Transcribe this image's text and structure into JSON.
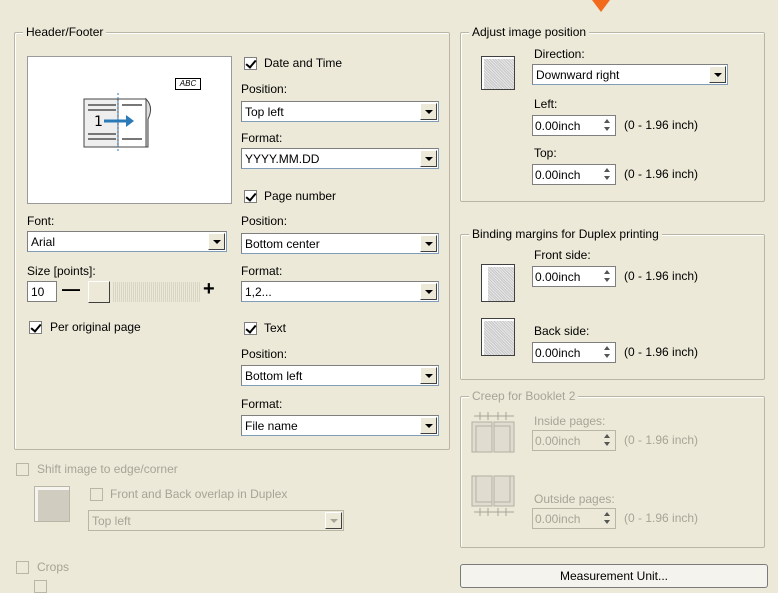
{
  "header_footer": {
    "title": "Header/Footer",
    "preview_tag": "ABC",
    "font_label": "Font:",
    "font_value": "Arial",
    "size_label": "Size [points]:",
    "size_value": "10",
    "size_minus": "—",
    "size_plus": "+",
    "per_original_label": "Per original page",
    "per_original_checked": true,
    "date_time": {
      "label": "Date and Time",
      "checked": true,
      "position_label": "Position:",
      "position_value": "Top left",
      "format_label": "Format:",
      "format_value": "YYYY.MM.DD"
    },
    "page_number": {
      "label": "Page number",
      "checked": true,
      "position_label": "Position:",
      "position_value": "Bottom center",
      "format_label": "Format:",
      "format_value": "1,2..."
    },
    "text": {
      "label": "Text",
      "checked": true,
      "position_label": "Position:",
      "position_value": "Bottom left",
      "format_label": "Format:",
      "format_value": "File name"
    }
  },
  "shift": {
    "label": "Shift image to edge/corner",
    "overlap_label": "Front and Back overlap in Duplex",
    "position_value": "Top left"
  },
  "crops": {
    "label": "Crops"
  },
  "adjust": {
    "title": "Adjust image position",
    "direction_label": "Direction:",
    "direction_value": "Downward right",
    "left_label": "Left:",
    "left_value": "0.00inch",
    "left_range": "(0 - 1.96 inch)",
    "top_label": "Top:",
    "top_value": "0.00inch",
    "top_range": "(0 - 1.96 inch)"
  },
  "binding": {
    "title": "Binding margins for Duplex printing",
    "front_label": "Front side:",
    "front_value": "0.00inch",
    "front_range": "(0 - 1.96 inch)",
    "back_label": "Back side:",
    "back_value": "0.00inch",
    "back_range": "(0 - 1.96 inch)"
  },
  "creep": {
    "title": "Creep for Booklet 2",
    "inside_label": "Inside pages:",
    "inside_value": "0.00inch",
    "inside_range": "(0 - 1.96 inch)",
    "outside_label": "Outside pages:",
    "outside_value": "0.00inch",
    "outside_range": "(0 - 1.96 inch)"
  },
  "measurement_button": "Measurement Unit...",
  "colors": {
    "face": "#ece9d8",
    "accent_arrow": "#f26b1d",
    "disabled_text": "#a7a497"
  }
}
